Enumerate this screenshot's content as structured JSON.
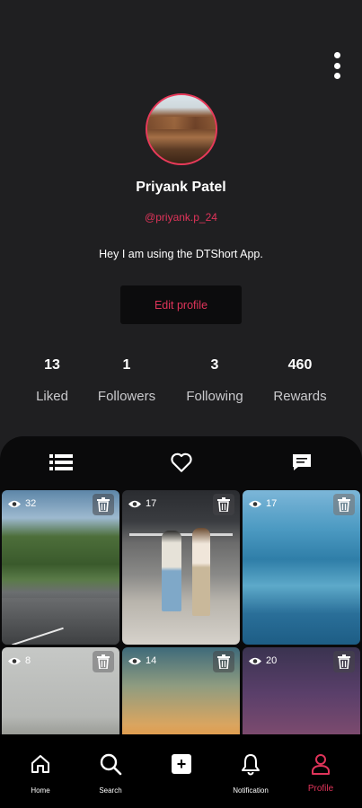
{
  "profile": {
    "name": "Priyank Patel",
    "handle": "@priyank.p_24",
    "bio": "Hey I am using the DTShort App.",
    "edit_label": "Edit profile"
  },
  "stats": [
    {
      "value": "13",
      "label": "Liked"
    },
    {
      "value": "1",
      "label": "Followers"
    },
    {
      "value": "3",
      "label": "Following"
    },
    {
      "value": "460",
      "label": "Rewards"
    }
  ],
  "tabs": [
    "list-icon",
    "heart-icon",
    "message-icon"
  ],
  "videos": [
    {
      "views": "32",
      "scene": "mountain road"
    },
    {
      "views": "17",
      "scene": "dancing couple"
    },
    {
      "views": "17",
      "scene": "blue lake"
    },
    {
      "views": "8",
      "scene": "foggy cliff"
    },
    {
      "views": "14",
      "scene": "sunset sky"
    },
    {
      "views": "20",
      "scene": "purple dusk"
    }
  ],
  "nav": {
    "home": "Home",
    "search": "Search",
    "add": "+",
    "notification": "Notification",
    "profile": "Profile"
  },
  "colors": {
    "accent": "#e0345a",
    "background": "#1f1f21",
    "panel": "#0a0a0b"
  }
}
